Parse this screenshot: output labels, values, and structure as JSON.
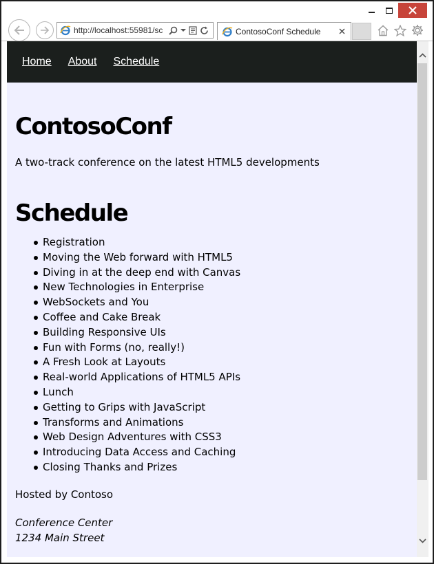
{
  "browser": {
    "address_url": "http://localhost:55981/sc",
    "tab_title": "ContosoConf Schedule",
    "icons": {
      "back": "back-arrow-icon",
      "forward": "forward-arrow-icon",
      "search": "search-icon",
      "dropdown": "chevron-down-icon",
      "compat": "compatibility-view-icon",
      "refresh": "refresh-icon",
      "home": "home-icon",
      "favorites": "star-icon",
      "tools": "gear-icon"
    }
  },
  "site_nav": {
    "links": [
      {
        "label": "Home"
      },
      {
        "label": "About"
      },
      {
        "label": "Schedule"
      }
    ]
  },
  "page": {
    "title": "ContosoConf",
    "tagline": "A two-track conference on the latest HTML5 developments",
    "schedule_heading": "Schedule",
    "sessions": [
      "Registration",
      "Moving the Web forward with HTML5",
      "Diving in at the deep end with Canvas",
      "New Technologies in Enterprise",
      "WebSockets and You",
      "Coffee and Cake Break",
      "Building Responsive UIs",
      "Fun with Forms (no, really!)",
      "A Fresh Look at Layouts",
      "Real-world Applications of HTML5 APIs",
      "Lunch",
      "Getting to Grips with JavaScript",
      "Transforms and Animations",
      "Web Design Adventures with CSS3",
      "Introducing Data Access and Caching",
      "Closing Thanks and Prizes"
    ],
    "hosted_by": "Hosted by Contoso",
    "address_lines": [
      "Conference Center",
      "1234 Main Street"
    ]
  },
  "colors": {
    "page_background": "#f0f0ff",
    "nav_background": "#1b1f1d",
    "close_button": "#c7443a"
  }
}
